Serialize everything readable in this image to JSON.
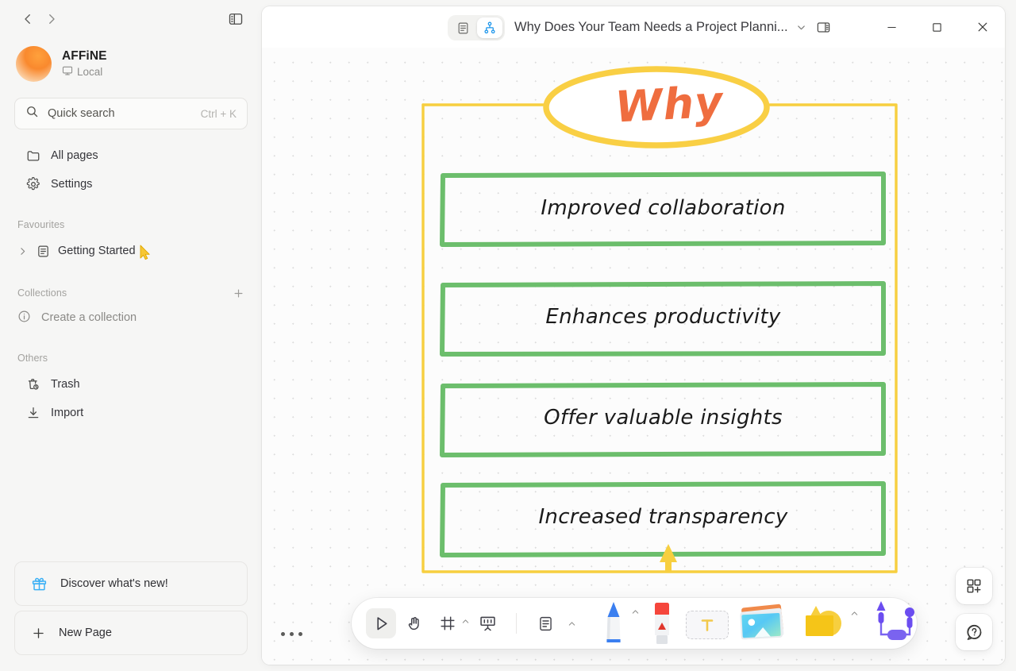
{
  "sidebar": {
    "nav": {
      "back_label": "Back",
      "forward_label": "Forward",
      "panel_toggle_label": "Toggle sidebar"
    },
    "workspace": {
      "name": "AFFiNE",
      "sub_label": "Local",
      "avatar_color": "#f9892e"
    },
    "search": {
      "label": "Quick search",
      "shortcut": "Ctrl + K"
    },
    "items": [
      {
        "label": "All pages",
        "icon": "folder-icon"
      },
      {
        "label": "Settings",
        "icon": "gear-icon"
      }
    ],
    "sections": {
      "favourites": {
        "title": "Favourites",
        "items": [
          {
            "label": "Getting Started",
            "icon": "doc-icon"
          }
        ]
      },
      "collections": {
        "title": "Collections",
        "add_label": "+",
        "empty_label": "Create a collection"
      },
      "others": {
        "title": "Others",
        "items": [
          {
            "label": "Trash",
            "icon": "trash-icon"
          },
          {
            "label": "Import",
            "icon": "import-icon"
          }
        ]
      }
    },
    "bottom": {
      "discover_label": "Discover what's new!",
      "new_page_label": "New Page"
    }
  },
  "titlebar": {
    "mode_page_label": "Page mode",
    "mode_edgeless_label": "Edgeless mode",
    "active_mode": "edgeless",
    "doc_title": "Why Does Your Team Needs a Project Planni...",
    "chevron_label": "More",
    "right_panel_label": "Toggle right sidebar",
    "window": {
      "minimize": "–",
      "maximize": "□",
      "close": "✕"
    }
  },
  "canvas": {
    "accent_yellow": "#f7cf3f",
    "accent_green": "#6cbe6c",
    "accent_orange": "#ef6d3f",
    "why_title": "Why",
    "boxes": [
      {
        "label": "Improved collaboration"
      },
      {
        "label": "Enhances productivity"
      },
      {
        "label": "Offer valuable insights"
      },
      {
        "label": "Increased transparency"
      }
    ]
  },
  "toolbar": {
    "select_label": "Select",
    "hand_label": "Hand",
    "frame_label": "Frame",
    "present_label": "Present",
    "note_label": "Note",
    "pen_label": "Pen",
    "eraser_label": "Eraser",
    "text_label": "Text",
    "image_label": "Image",
    "shape_label": "Shape",
    "connector_label": "Connector",
    "active_tool": "select"
  },
  "side_buttons": {
    "toolbar_add_label": "Add widget",
    "help_label": "Help"
  },
  "zoom_bar": {
    "collapsed_label": "..."
  }
}
